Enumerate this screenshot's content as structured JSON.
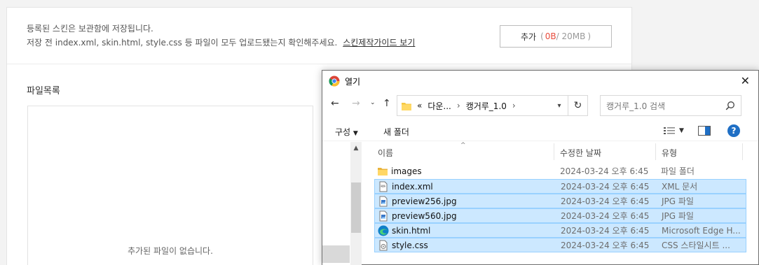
{
  "page": {
    "info_line1": "등록된 스킨은 보관함에 저장됩니다.",
    "info_line2": "저장 전 index.xml, skin.html, style.css 등 파일이 모두 업로드됐는지 확인해주세요.",
    "guide_link": "스킨제작가이드 보기",
    "add_button": {
      "label": "추가",
      "paren_open": "(",
      "used": "0B",
      "total": " / 20MB",
      "paren_close": ")"
    },
    "file_list_title": "파일목록",
    "empty_message": "추가된 파일이 없습니다."
  },
  "dialog": {
    "title": "열기",
    "close": "✕",
    "address": {
      "overflow": "«",
      "segments": [
        "다운...",
        "캥거루_1.0"
      ]
    },
    "search_placeholder": "캥거루_1.0 검색",
    "toolbar": {
      "organize": "구성",
      "new_folder": "새 폴더"
    },
    "columns": {
      "name": "이름",
      "modified": "수정한 날짜",
      "type": "유형"
    },
    "files": [
      {
        "name": "images",
        "date": "2024-03-24 오후 6:45",
        "type": "파일 폴더",
        "icon": "folder-icon",
        "selected": false
      },
      {
        "name": "index.xml",
        "date": "2024-03-24 오후 6:45",
        "type": "XML 문서",
        "icon": "xml-file-icon",
        "selected": true
      },
      {
        "name": "preview256.jpg",
        "date": "2024-03-24 오후 6:45",
        "type": "JPG 파일",
        "icon": "image-file-icon",
        "selected": true
      },
      {
        "name": "preview560.jpg",
        "date": "2024-03-24 오후 6:45",
        "type": "JPG 파일",
        "icon": "image-file-icon",
        "selected": true
      },
      {
        "name": "skin.html",
        "date": "2024-03-24 오후 6:45",
        "type": "Microsoft Edge H...",
        "icon": "edge-icon",
        "selected": true
      },
      {
        "name": "style.css",
        "date": "2024-03-24 오후 6:45",
        "type": "CSS 스타일시트 ...",
        "icon": "css-file-icon",
        "selected": true
      }
    ]
  },
  "colors": {
    "accent_red": "#e74c3c",
    "selection": "#cce8ff",
    "selection_border": "#99d1ff",
    "help_blue": "#1f6fc5"
  }
}
